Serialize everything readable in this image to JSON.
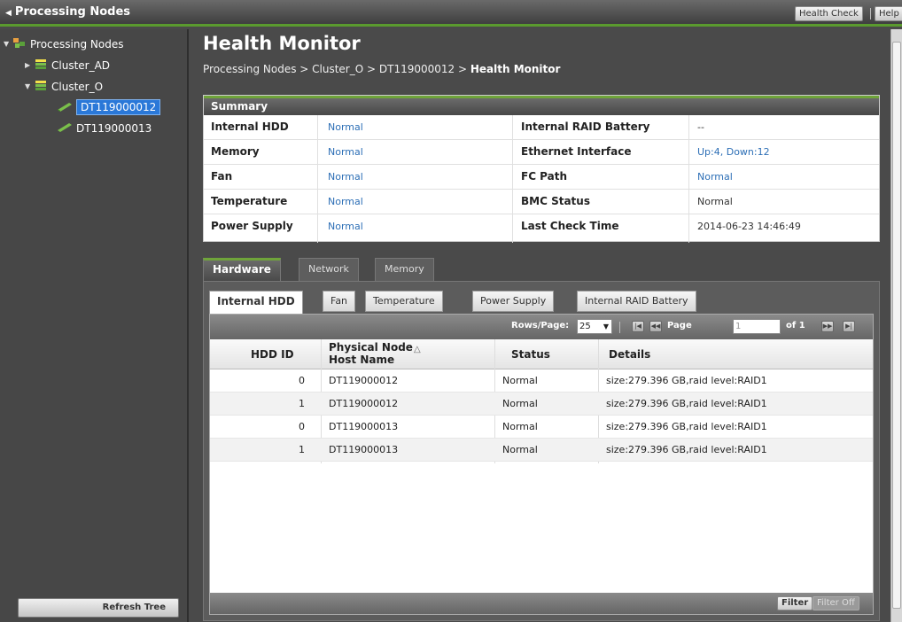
{
  "topbar": {
    "title": "Processing Nodes",
    "health_check": "Health Check",
    "help": "Help"
  },
  "tree": {
    "items": [
      {
        "label": "Processing Nodes"
      },
      {
        "label": "Cluster_AD"
      },
      {
        "label": "Cluster_O"
      },
      {
        "label": "DT119000012"
      },
      {
        "label": "DT119000013"
      }
    ],
    "refresh": "Refresh Tree"
  },
  "page": {
    "title": "Health Monitor",
    "breadcrumb_prefix": "Processing Nodes > Cluster_O > DT119000012 > ",
    "breadcrumb_current": "Health Monitor"
  },
  "summary": {
    "heading": "Summary",
    "rows": [
      {
        "k1": "Internal HDD",
        "v1": "Normal",
        "k2": "Internal RAID Battery",
        "v2": "--"
      },
      {
        "k1": "Memory",
        "v1": "Normal",
        "k2": "Ethernet Interface",
        "v2": "Up:4, Down:12"
      },
      {
        "k1": "Fan",
        "v1": "Normal",
        "k2": "FC Path",
        "v2": "Normal"
      },
      {
        "k1": "Temperature",
        "v1": "Normal",
        "k2": "BMC Status",
        "v2": "Normal"
      },
      {
        "k1": "Power Supply",
        "v1": "Normal",
        "k2": "Last Check Time",
        "v2": "2014-06-23 14:46:49"
      }
    ]
  },
  "tabs": {
    "main": [
      "Hardware",
      "Network",
      "Memory"
    ],
    "sub": [
      "Internal HDD",
      "Fan",
      "Temperature",
      "Power Supply",
      "Internal RAID Battery"
    ]
  },
  "grid": {
    "rows_per_page_label": "Rows/Page:",
    "rows_per_page": "25",
    "page_label": "Page",
    "page_value": "1",
    "of_label": "of 1",
    "columns": [
      "HDD ID",
      "Physical Node Host Name",
      "Status",
      "Details"
    ],
    "rows": [
      {
        "id": "0",
        "host": "DT119000012",
        "status": "Normal",
        "details": "size:279.396 GB,raid level:RAID1"
      },
      {
        "id": "1",
        "host": "DT119000012",
        "status": "Normal",
        "details": "size:279.396 GB,raid level:RAID1"
      },
      {
        "id": "0",
        "host": "DT119000013",
        "status": "Normal",
        "details": "size:279.396 GB,raid level:RAID1"
      },
      {
        "id": "1",
        "host": "DT119000013",
        "status": "Normal",
        "details": "size:279.396 GB,raid level:RAID1"
      }
    ],
    "filter": "Filter",
    "filter_off": "Filter Off"
  }
}
